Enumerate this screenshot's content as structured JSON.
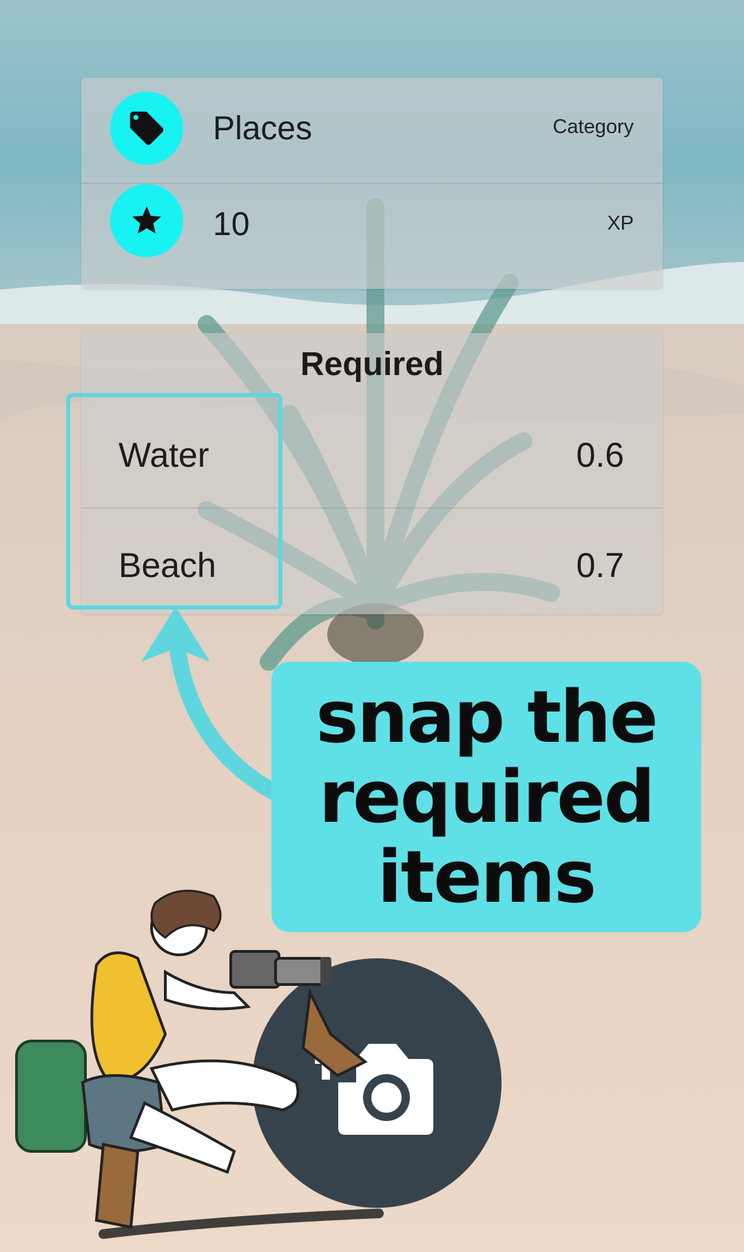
{
  "info_card": {
    "category": {
      "icon": "tag-icon",
      "value": "Places",
      "label": "Category"
    },
    "xp": {
      "icon": "star-icon",
      "value": "10",
      "label": "XP"
    }
  },
  "required_card": {
    "title": "Required",
    "items": [
      {
        "name": "Water",
        "value": "0.6"
      },
      {
        "name": "Beach",
        "value": "0.7"
      }
    ]
  },
  "tooltip": {
    "line1": "snap the",
    "line2": "required",
    "line3": "items"
  },
  "fab": {
    "icon": "add-photo-camera-icon"
  },
  "colors": {
    "icon_circle": "#18f2f2",
    "highlight": "#5fd6de",
    "bubble": "#5ee0e6",
    "fab": "#36434c"
  }
}
